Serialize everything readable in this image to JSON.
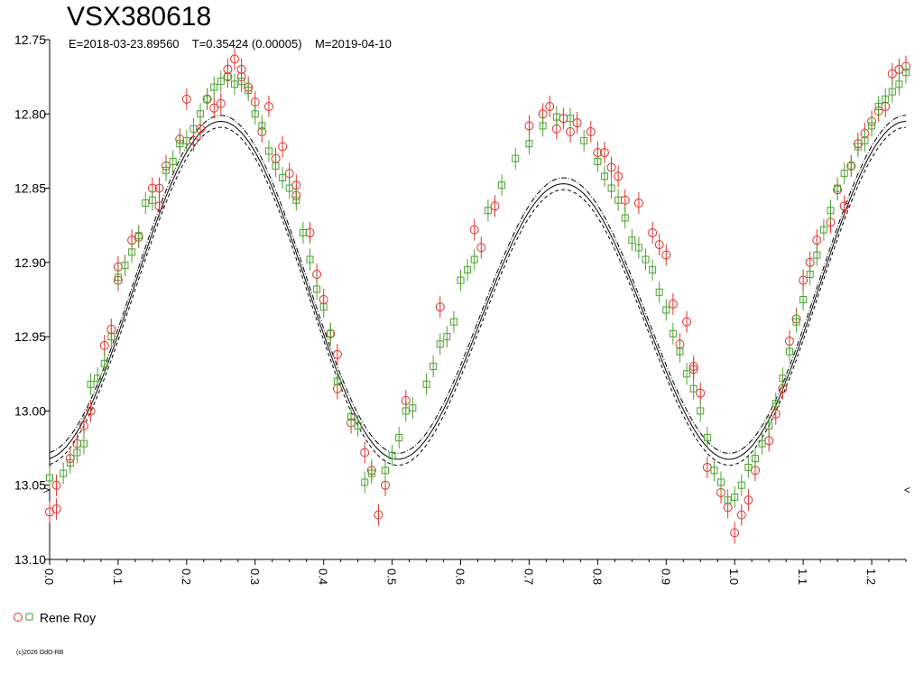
{
  "header": {
    "title": "VSX380618",
    "subtitle": "E=2018-03-23.89560    T=0.35424 (0.00005)    M=2019-04-10"
  },
  "legend": {
    "observer": "Rene Roy"
  },
  "footer": {
    "copyright": "(c)2026 OdO-RB"
  },
  "markers": {
    "left": ">",
    "right": "<"
  },
  "chart_data": {
    "type": "scatter",
    "title": "VSX380618",
    "xlim": [
      0.0,
      1.25
    ],
    "ylim": [
      12.75,
      13.1
    ],
    "y_inverted": true,
    "x_ticks": [
      "0.0",
      "0.1",
      "0.2",
      "0.3",
      "0.4",
      "0.5",
      "0.6",
      "0.7",
      "0.8",
      "0.9",
      "1.0",
      "1.1",
      "1.2"
    ],
    "y_ticks": [
      "12.75",
      "12.80",
      "12.85",
      "12.90",
      "12.95",
      "13.00",
      "13.05",
      "13.10"
    ],
    "colors": {
      "series_a": "#e0302a",
      "series_b": "#4aa030",
      "fit": "#000000"
    },
    "fit_model": {
      "mean": 12.929,
      "amp_half_period": 0.103,
      "amp_period": 0.021,
      "bands": 0.004
    },
    "series": [
      {
        "name": "Rene Roy",
        "marker": "circle",
        "color": "#e0302a",
        "points": [
          [
            0.0,
            13.068
          ],
          [
            0.01,
            13.05
          ],
          [
            0.01,
            13.066
          ],
          [
            0.03,
            13.032
          ],
          [
            0.04,
            13.022
          ],
          [
            0.05,
            13.01
          ],
          [
            0.06,
            13.0
          ],
          [
            0.08,
            12.956
          ],
          [
            0.09,
            12.945
          ],
          [
            0.1,
            12.912
          ],
          [
            0.1,
            12.903
          ],
          [
            0.12,
            12.885
          ],
          [
            0.13,
            12.883
          ],
          [
            0.15,
            12.85
          ],
          [
            0.16,
            12.862
          ],
          [
            0.16,
            12.85
          ],
          [
            0.17,
            12.835
          ],
          [
            0.19,
            12.817
          ],
          [
            0.2,
            12.79
          ],
          [
            0.21,
            12.818
          ],
          [
            0.22,
            12.81
          ],
          [
            0.23,
            12.79
          ],
          [
            0.24,
            12.796
          ],
          [
            0.25,
            12.793
          ],
          [
            0.26,
            12.77
          ],
          [
            0.26,
            12.775
          ],
          [
            0.27,
            12.763
          ],
          [
            0.28,
            12.77
          ],
          [
            0.28,
            12.775
          ],
          [
            0.29,
            12.782
          ],
          [
            0.3,
            12.792
          ],
          [
            0.31,
            12.812
          ],
          [
            0.32,
            12.795
          ],
          [
            0.33,
            12.83
          ],
          [
            0.34,
            12.822
          ],
          [
            0.35,
            12.84
          ],
          [
            0.36,
            12.848
          ],
          [
            0.36,
            12.855
          ],
          [
            0.38,
            12.88
          ],
          [
            0.39,
            12.908
          ],
          [
            0.4,
            12.925
          ],
          [
            0.41,
            12.948
          ],
          [
            0.42,
            12.962
          ],
          [
            0.42,
            12.985
          ],
          [
            0.44,
            13.008
          ],
          [
            0.46,
            13.028
          ],
          [
            0.47,
            13.04
          ],
          [
            0.48,
            13.07
          ],
          [
            0.49,
            13.05
          ],
          [
            0.52,
            12.993
          ],
          [
            0.57,
            12.93
          ],
          [
            0.62,
            12.878
          ],
          [
            0.63,
            12.89
          ],
          [
            0.65,
            12.862
          ],
          [
            0.7,
            12.808
          ],
          [
            0.72,
            12.8
          ],
          [
            0.73,
            12.795
          ],
          [
            0.74,
            12.81
          ],
          [
            0.75,
            12.803
          ],
          [
            0.76,
            12.812
          ],
          [
            0.77,
            12.806
          ],
          [
            0.79,
            12.812
          ],
          [
            0.8,
            12.826
          ],
          [
            0.81,
            12.826
          ],
          [
            0.82,
            12.836
          ],
          [
            0.83,
            12.842
          ],
          [
            0.84,
            12.858
          ],
          [
            0.86,
            12.86
          ],
          [
            0.88,
            12.88
          ],
          [
            0.89,
            12.888
          ],
          [
            0.9,
            12.895
          ],
          [
            0.91,
            12.928
          ],
          [
            0.92,
            12.955
          ],
          [
            0.93,
            12.94
          ],
          [
            0.94,
            12.97
          ],
          [
            0.94,
            12.972
          ],
          [
            0.95,
            12.988
          ],
          [
            0.96,
            13.038
          ],
          [
            0.98,
            13.055
          ],
          [
            0.99,
            13.065
          ],
          [
            1.0,
            13.082
          ],
          [
            1.01,
            13.07
          ],
          [
            1.02,
            13.06
          ],
          [
            1.03,
            13.04
          ],
          [
            1.05,
            13.02
          ],
          [
            1.06,
            13.002
          ],
          [
            1.07,
            12.985
          ],
          [
            1.08,
            12.953
          ],
          [
            1.09,
            12.938
          ],
          [
            1.1,
            12.912
          ],
          [
            1.11,
            12.9
          ],
          [
            1.12,
            12.885
          ],
          [
            1.14,
            12.873
          ],
          [
            1.15,
            12.851
          ],
          [
            1.16,
            12.862
          ],
          [
            1.17,
            12.835
          ],
          [
            1.18,
            12.82
          ],
          [
            1.19,
            12.813
          ],
          [
            1.2,
            12.805
          ],
          [
            1.21,
            12.798
          ],
          [
            1.22,
            12.795
          ],
          [
            1.23,
            12.773
          ],
          [
            1.24,
            12.77
          ],
          [
            1.25,
            12.768
          ]
        ]
      },
      {
        "name": "",
        "marker": "square",
        "color": "#4aa030",
        "points": [
          [
            0.0,
            13.045
          ],
          [
            0.02,
            13.042
          ],
          [
            0.03,
            13.035
          ],
          [
            0.04,
            13.028
          ],
          [
            0.05,
            13.022
          ],
          [
            0.06,
            12.982
          ],
          [
            0.07,
            12.978
          ],
          [
            0.08,
            12.968
          ],
          [
            0.09,
            12.95
          ],
          [
            0.1,
            12.91
          ],
          [
            0.11,
            12.902
          ],
          [
            0.12,
            12.893
          ],
          [
            0.13,
            12.882
          ],
          [
            0.14,
            12.86
          ],
          [
            0.15,
            12.858
          ],
          [
            0.17,
            12.838
          ],
          [
            0.18,
            12.832
          ],
          [
            0.19,
            12.82
          ],
          [
            0.2,
            12.818
          ],
          [
            0.21,
            12.81
          ],
          [
            0.22,
            12.8
          ],
          [
            0.23,
            12.79
          ],
          [
            0.24,
            12.782
          ],
          [
            0.25,
            12.778
          ],
          [
            0.26,
            12.775
          ],
          [
            0.27,
            12.78
          ],
          [
            0.28,
            12.778
          ],
          [
            0.29,
            12.784
          ],
          [
            0.3,
            12.8
          ],
          [
            0.31,
            12.808
          ],
          [
            0.32,
            12.825
          ],
          [
            0.33,
            12.835
          ],
          [
            0.34,
            12.843
          ],
          [
            0.35,
            12.85
          ],
          [
            0.36,
            12.858
          ],
          [
            0.37,
            12.88
          ],
          [
            0.38,
            12.898
          ],
          [
            0.39,
            12.918
          ],
          [
            0.4,
            12.93
          ],
          [
            0.41,
            12.948
          ],
          [
            0.42,
            12.98
          ],
          [
            0.44,
            13.004
          ],
          [
            0.45,
            13.01
          ],
          [
            0.46,
            13.048
          ],
          [
            0.47,
            13.042
          ],
          [
            0.49,
            13.04
          ],
          [
            0.5,
            13.03
          ],
          [
            0.51,
            13.018
          ],
          [
            0.52,
            13.0
          ],
          [
            0.53,
            12.998
          ],
          [
            0.55,
            12.982
          ],
          [
            0.56,
            12.97
          ],
          [
            0.57,
            12.955
          ],
          [
            0.58,
            12.95
          ],
          [
            0.59,
            12.94
          ],
          [
            0.6,
            12.912
          ],
          [
            0.61,
            12.905
          ],
          [
            0.62,
            12.898
          ],
          [
            0.64,
            12.865
          ],
          [
            0.66,
            12.848
          ],
          [
            0.68,
            12.83
          ],
          [
            0.7,
            12.82
          ],
          [
            0.72,
            12.808
          ],
          [
            0.74,
            12.802
          ],
          [
            0.76,
            12.803
          ],
          [
            0.78,
            12.818
          ],
          [
            0.8,
            12.832
          ],
          [
            0.81,
            12.842
          ],
          [
            0.82,
            12.85
          ],
          [
            0.83,
            12.858
          ],
          [
            0.84,
            12.87
          ],
          [
            0.85,
            12.885
          ],
          [
            0.86,
            12.89
          ],
          [
            0.87,
            12.898
          ],
          [
            0.88,
            12.905
          ],
          [
            0.89,
            12.92
          ],
          [
            0.9,
            12.932
          ],
          [
            0.91,
            12.948
          ],
          [
            0.92,
            12.96
          ],
          [
            0.93,
            12.975
          ],
          [
            0.94,
            12.985
          ],
          [
            0.95,
            13.0
          ],
          [
            0.96,
            13.018
          ],
          [
            0.97,
            13.04
          ],
          [
            0.98,
            13.048
          ],
          [
            0.99,
            13.06
          ],
          [
            1.0,
            13.058
          ],
          [
            1.01,
            13.05
          ],
          [
            1.02,
            13.038
          ],
          [
            1.03,
            13.032
          ],
          [
            1.04,
            13.022
          ],
          [
            1.05,
            13.01
          ],
          [
            1.06,
            12.995
          ],
          [
            1.07,
            12.978
          ],
          [
            1.08,
            12.96
          ],
          [
            1.09,
            12.94
          ],
          [
            1.1,
            12.925
          ],
          [
            1.11,
            12.908
          ],
          [
            1.12,
            12.895
          ],
          [
            1.13,
            12.878
          ],
          [
            1.14,
            12.865
          ],
          [
            1.15,
            12.85
          ],
          [
            1.16,
            12.84
          ],
          [
            1.17,
            12.835
          ],
          [
            1.18,
            12.822
          ],
          [
            1.19,
            12.818
          ],
          [
            1.2,
            12.808
          ],
          [
            1.21,
            12.795
          ],
          [
            1.22,
            12.79
          ],
          [
            1.23,
            12.785
          ],
          [
            1.24,
            12.78
          ],
          [
            1.25,
            12.772
          ]
        ]
      }
    ]
  }
}
